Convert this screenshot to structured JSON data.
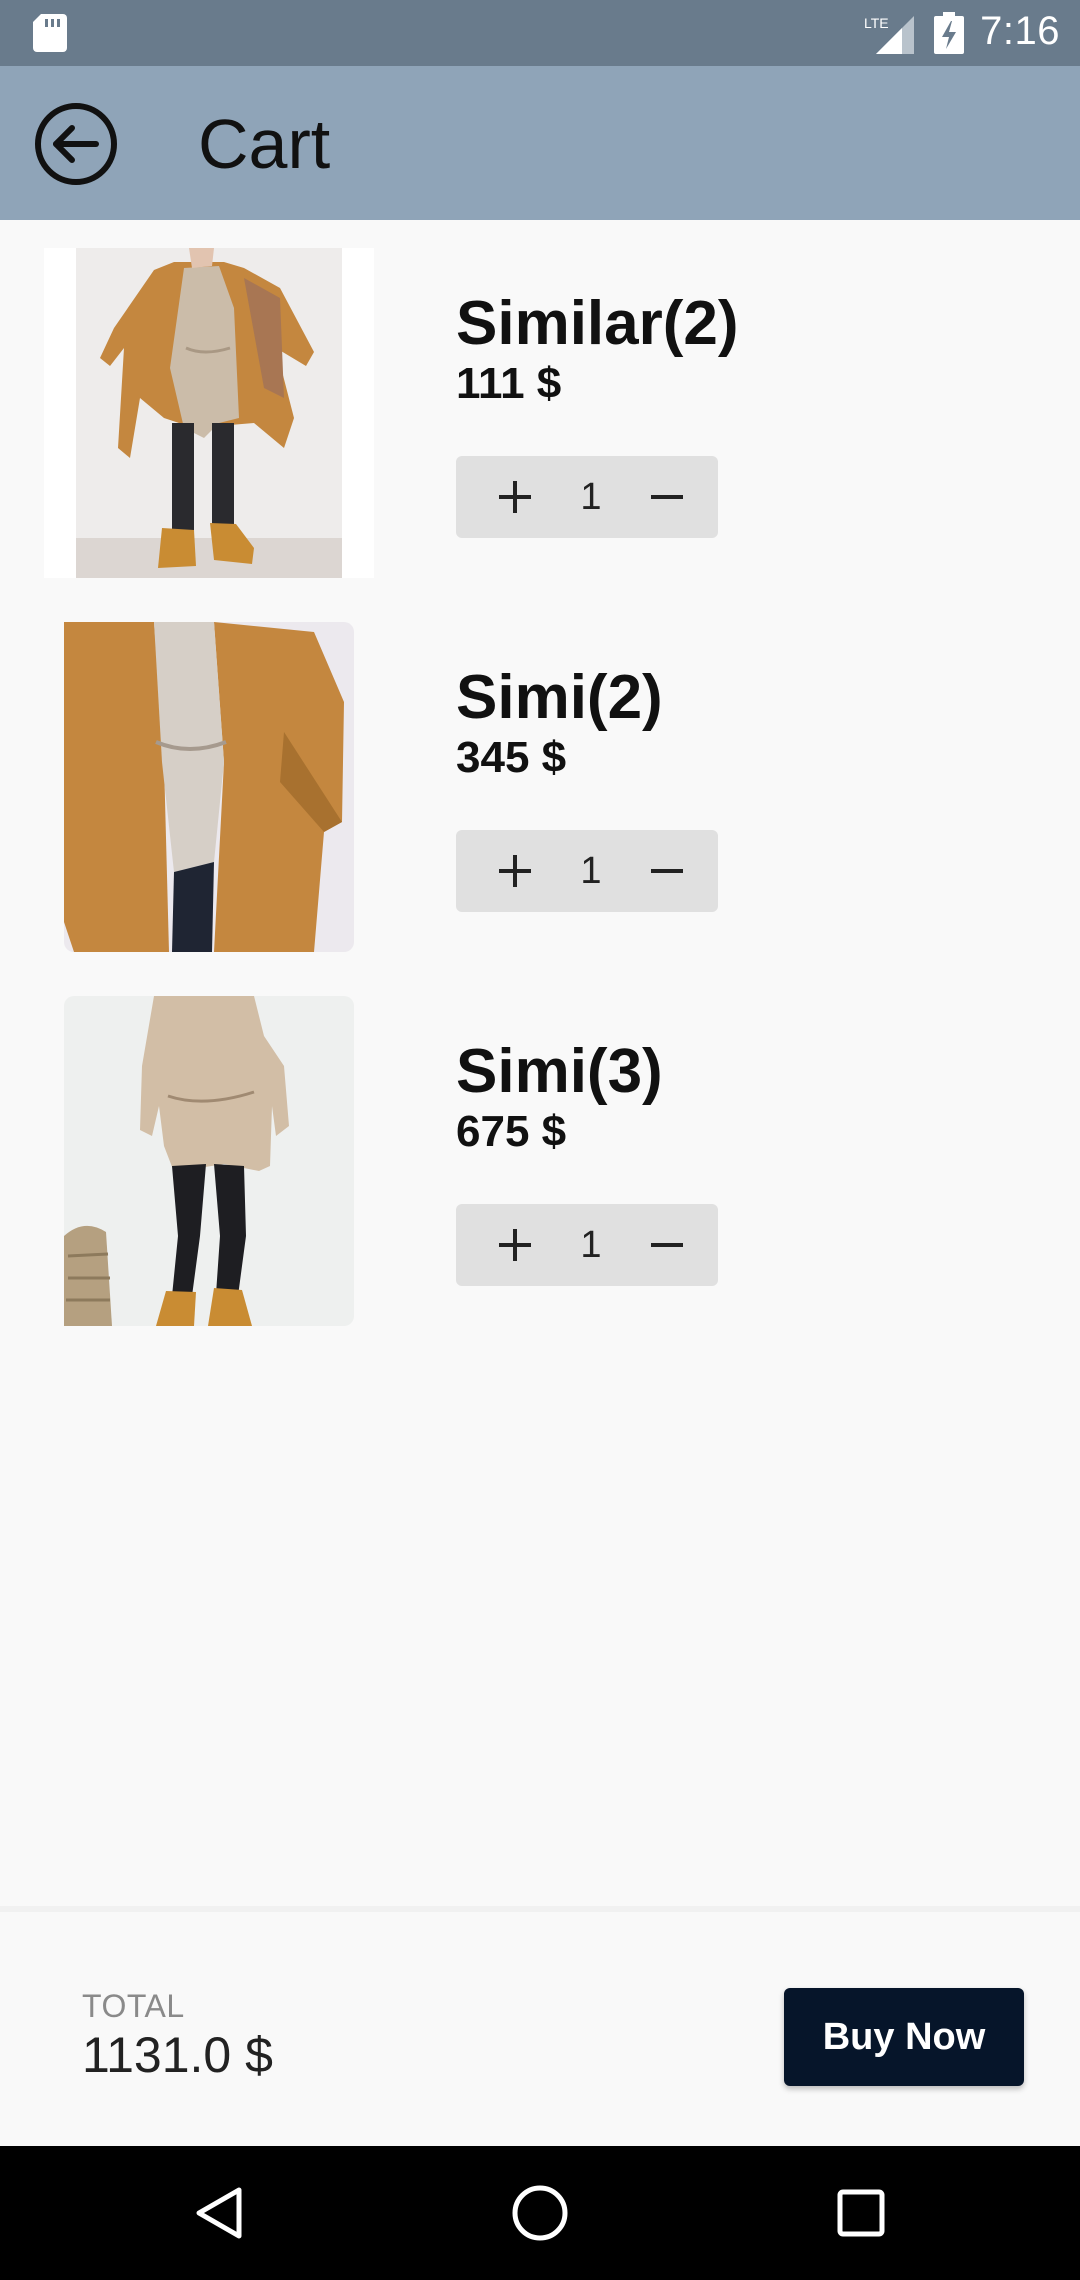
{
  "status_bar": {
    "time": "7:16",
    "network": "LTE",
    "icons": [
      "sd-card-icon",
      "lte-signal-icon",
      "battery-charging-icon"
    ]
  },
  "app_bar": {
    "title": "Cart",
    "back_icon": "back-arrow-circle-icon"
  },
  "cart": {
    "items": [
      {
        "name": "Similar(2)",
        "price": "111 $",
        "quantity": "1"
      },
      {
        "name": "Simi(2)",
        "price": "345 $",
        "quantity": "1"
      },
      {
        "name": "Simi(3)",
        "price": "675 $",
        "quantity": "1"
      }
    ]
  },
  "footer": {
    "total_label": "TOTAL",
    "total_value": "1131.0 $",
    "buy_label": "Buy Now"
  },
  "nav_bar": {
    "icons": [
      "back-triangle-icon",
      "home-circle-icon",
      "recents-square-icon"
    ]
  },
  "colors": {
    "status_bar": "#697b8c",
    "app_bar": "#8fa4b8",
    "background": "#f9f9f9",
    "stepper": "#e0e0e0",
    "buy_button": "#06152a",
    "coat": "#c4873f"
  }
}
